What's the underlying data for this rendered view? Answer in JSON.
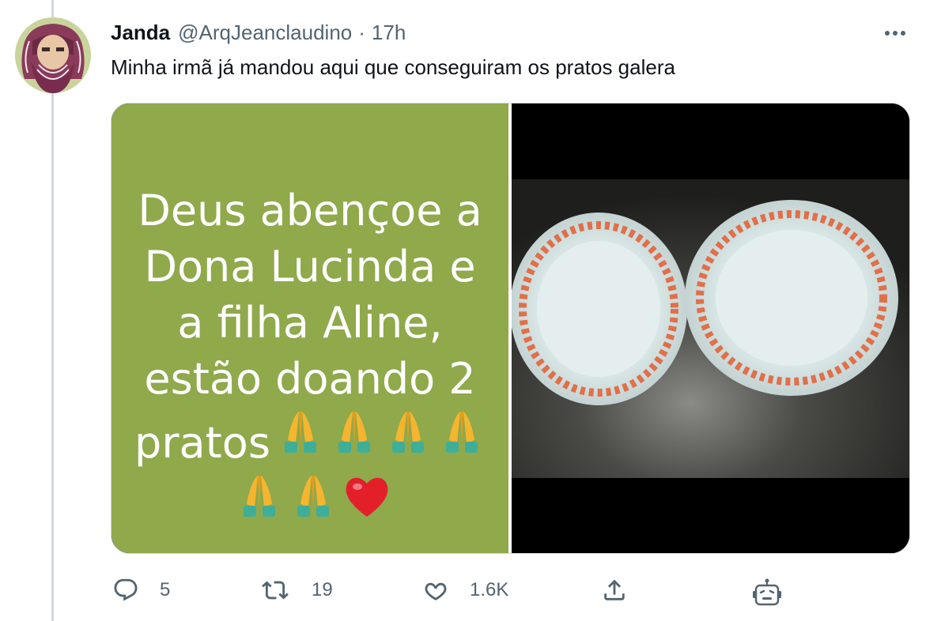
{
  "tweet": {
    "author_name": "Janda",
    "handle": "@ArqJeanclaudino",
    "separator": "·",
    "time": "17h",
    "text": "Minha irmã já mandou aqui que conseguiram os pratos galera",
    "avatar_icon": "portrait-avatar",
    "more_icon": "more-horizontal-icon"
  },
  "media": {
    "left_image": {
      "lines": [
        "Deus abençoe a",
        "Dona Lucinda e",
        "a filha Aline,",
        "estão doando 2",
        "pratos"
      ],
      "emojis": [
        "folded-hands",
        "folded-hands",
        "folded-hands",
        "folded-hands",
        "folded-hands",
        "folded-hands",
        "red-heart"
      ],
      "background": "#8fa94b"
    },
    "right_image": {
      "description_icon": "two-plates-photo"
    }
  },
  "actions": {
    "reply_count": "5",
    "retweet_count": "19",
    "like_count": "1.6K"
  },
  "colors": {
    "text": "#0f1419",
    "secondary": "#536471",
    "border": "#cfd9de",
    "plate_pattern": "#e0704a"
  }
}
